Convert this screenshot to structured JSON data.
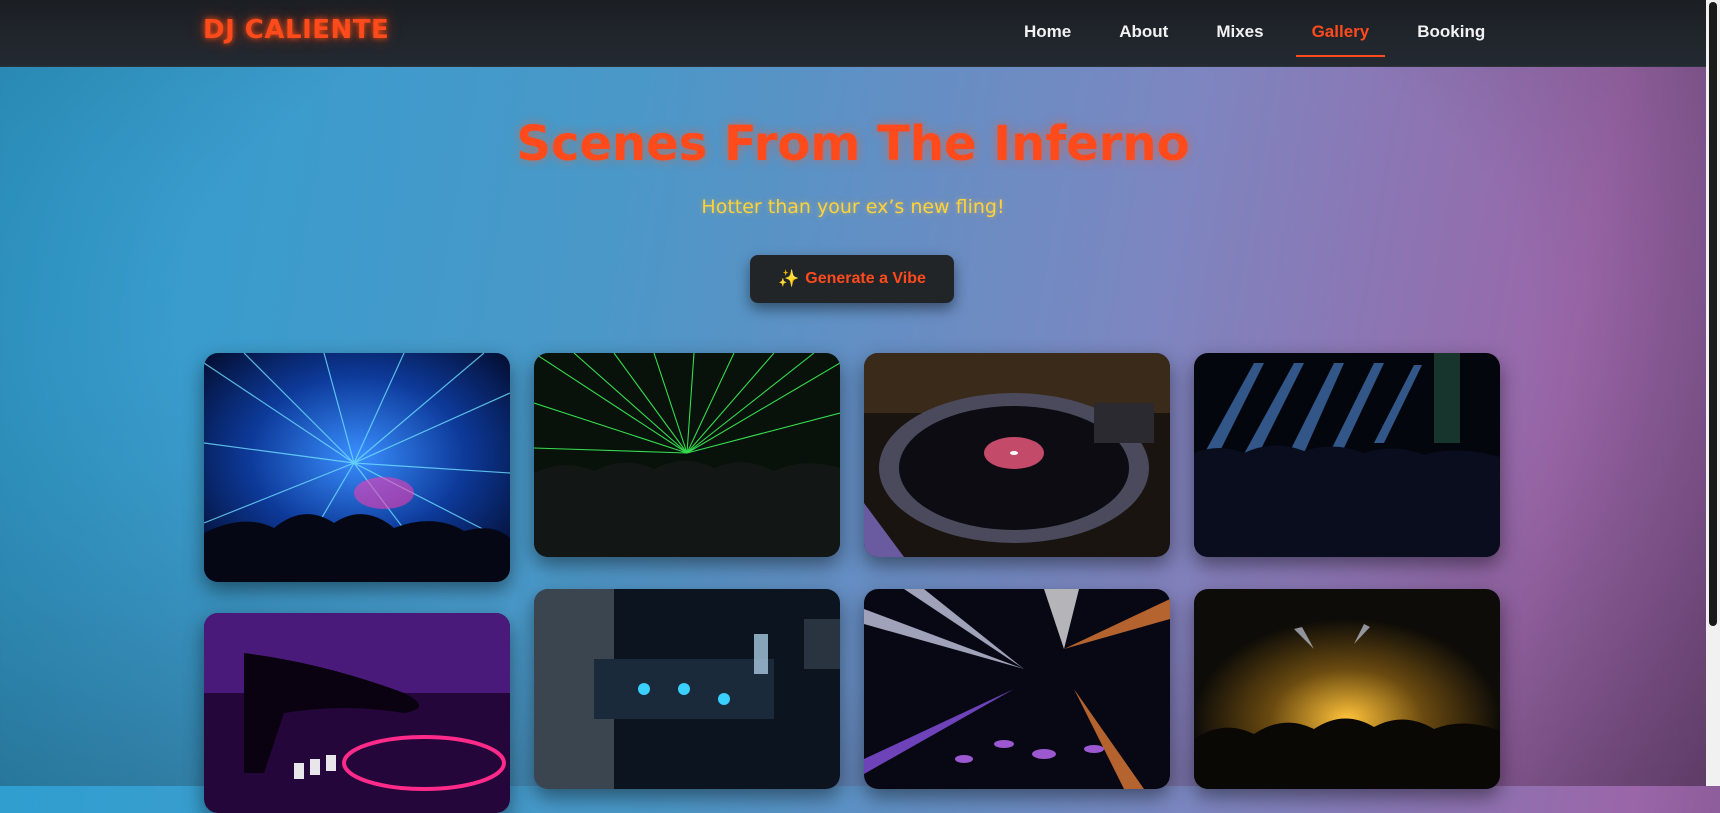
{
  "logo": "DJ CALIENTE",
  "nav": [
    {
      "label": "Home",
      "active": false
    },
    {
      "label": "About",
      "active": false
    },
    {
      "label": "Mixes",
      "active": false
    },
    {
      "label": "Gallery",
      "active": true
    },
    {
      "label": "Booking",
      "active": false
    }
  ],
  "hero": {
    "title": "Scenes From The Inferno",
    "subtitle": "Hotter than your ex’s new fling!",
    "button_icon": "sparkles-icon",
    "button_label": "Generate a Vibe"
  },
  "gallery": [
    {
      "id": "blue-lasers-crowd"
    },
    {
      "id": "green-lasers-crowd"
    },
    {
      "id": "turntable-closeup"
    },
    {
      "id": "stage-spotlights"
    },
    {
      "id": "purple-dj-hand"
    },
    {
      "id": "dj-mixer-booth"
    },
    {
      "id": "white-orange-beams"
    },
    {
      "id": "golden-concert-crowd"
    }
  ],
  "colors": {
    "accent": "#ff4a1c",
    "subtitle": "#ffd23a",
    "navbar": "#1f242a"
  }
}
